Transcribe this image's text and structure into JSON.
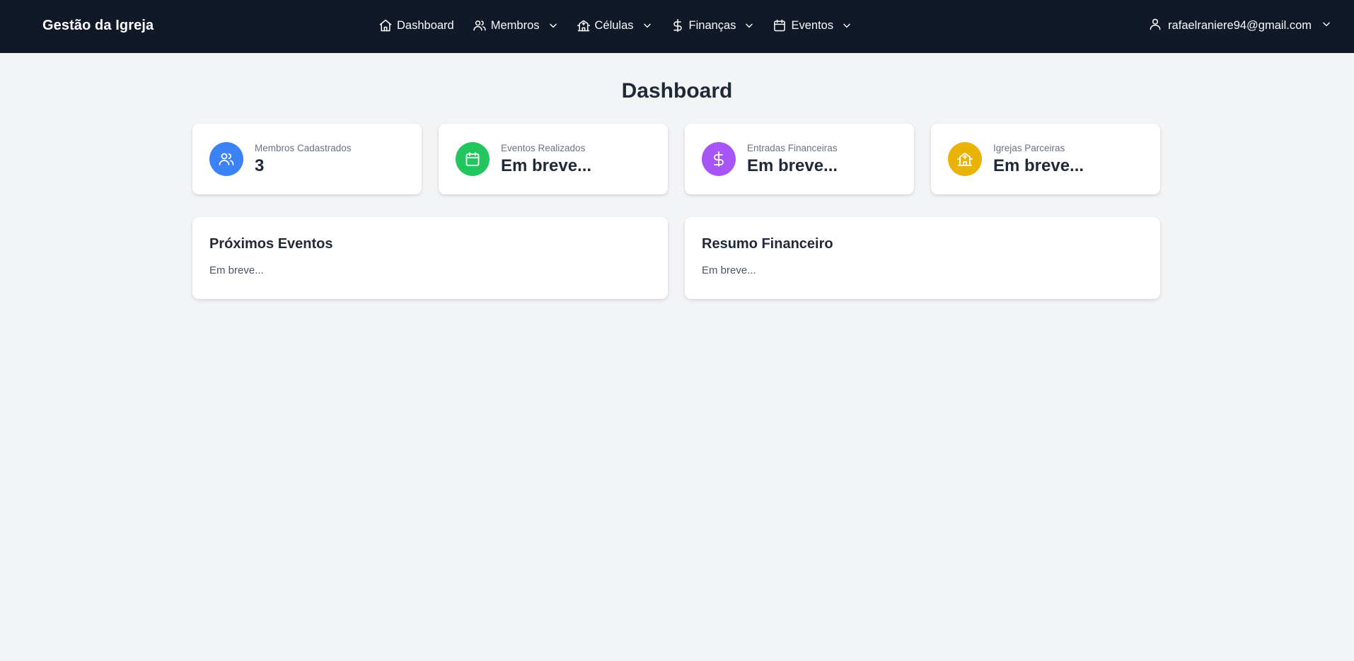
{
  "header": {
    "brand": "Gestão da Igreja",
    "nav": [
      {
        "label": "Dashboard",
        "icon": "home-icon",
        "has_dropdown": false
      },
      {
        "label": "Membros",
        "icon": "users-icon",
        "has_dropdown": true
      },
      {
        "label": "Células",
        "icon": "building-icon",
        "has_dropdown": true
      },
      {
        "label": "Finanças",
        "icon": "dollar-icon",
        "has_dropdown": true
      },
      {
        "label": "Eventos",
        "icon": "calendar-icon",
        "has_dropdown": true
      }
    ],
    "user_email": "rafaelraniere94@gmail.com"
  },
  "main": {
    "title": "Dashboard",
    "stats": [
      {
        "label": "Membros Cadastrados",
        "value": "3",
        "icon": "users-icon",
        "color": "#3b82f6"
      },
      {
        "label": "Eventos Realizados",
        "value": "Em breve...",
        "icon": "calendar-icon",
        "color": "#22c55e"
      },
      {
        "label": "Entradas Financeiras",
        "value": "Em breve...",
        "icon": "dollar-icon",
        "color": "#a855f7"
      },
      {
        "label": "Igrejas Parceiras",
        "value": "Em breve...",
        "icon": "building-icon",
        "color": "#eab308"
      }
    ],
    "panels": [
      {
        "title": "Próximos Eventos",
        "text": "Em breve..."
      },
      {
        "title": "Resumo Financeiro",
        "text": "Em breve..."
      }
    ]
  },
  "colors": {
    "header_bg": "#111827",
    "page_bg": "#f3f4f6"
  }
}
